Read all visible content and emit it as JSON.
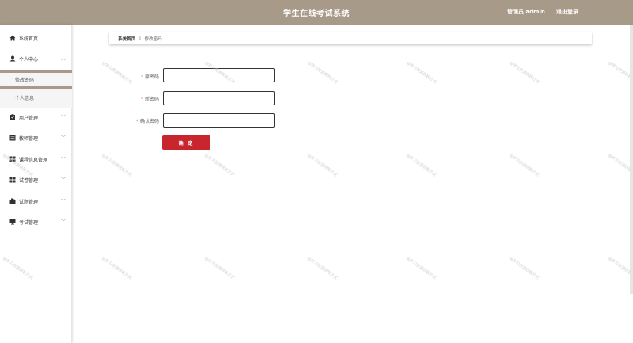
{
  "header": {
    "title": "学生在线考试系统",
    "user_label": "管理员 admin",
    "logout_label": "退出登录"
  },
  "sidebar": {
    "items": [
      {
        "label": "系统首页",
        "icon": "home-icon"
      },
      {
        "label": "个人中心",
        "icon": "user-icon"
      },
      {
        "label": "用户管理",
        "icon": "users-icon"
      },
      {
        "label": "教师管理",
        "icon": "teacher-icon"
      },
      {
        "label": "课程信息管理",
        "icon": "grid-icon"
      },
      {
        "label": "试卷管理",
        "icon": "grid-icon"
      },
      {
        "label": "试题管理",
        "icon": "question-icon"
      },
      {
        "label": "考试管理",
        "icon": "monitor-icon"
      }
    ],
    "subitems": [
      {
        "label": "修改密码"
      },
      {
        "label": "个人信息"
      }
    ]
  },
  "breadcrumb": {
    "home": "系统首页",
    "separator": "∶",
    "current": "修改密码"
  },
  "form": {
    "old_password_label": "原密码",
    "new_password_label": "新密码",
    "confirm_password_label": "确认密码",
    "required_mark": "*",
    "old_password_value": "",
    "new_password_value": "",
    "confirm_password_value": "",
    "submit_label": "确 定"
  },
  "watermark_text": "@学习资源获取方式",
  "colors": {
    "header_bg": "#a89a88",
    "submit_bg": "#c8252c",
    "required": "#f56c6c"
  }
}
